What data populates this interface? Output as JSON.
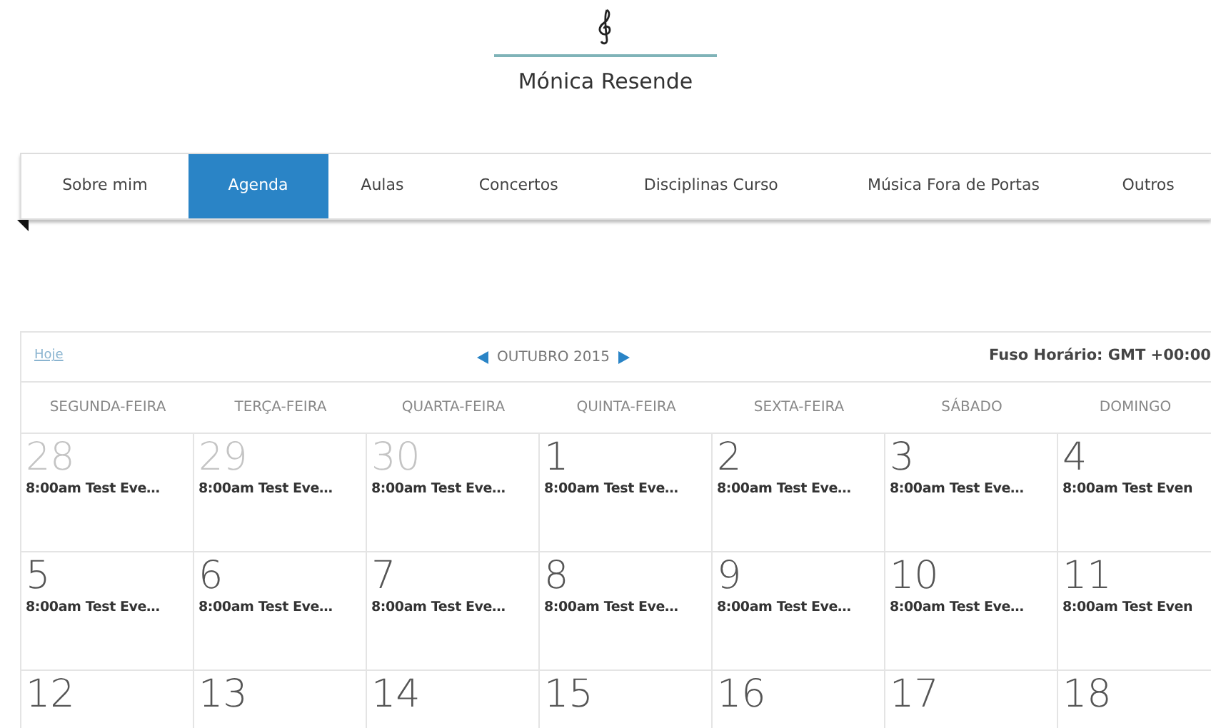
{
  "header": {
    "title": "Mónica Resende"
  },
  "nav": {
    "tabs": [
      {
        "label": "Sobre mim",
        "selected": false
      },
      {
        "label": "Agenda",
        "selected": true
      },
      {
        "label": "Aulas",
        "selected": false
      },
      {
        "label": "Concertos",
        "selected": false
      },
      {
        "label": "Disciplinas Curso",
        "selected": false
      },
      {
        "label": "Música Fora de Portas",
        "selected": false
      },
      {
        "label": "Outros",
        "selected": false
      }
    ]
  },
  "calendar": {
    "today_link": "Hoje",
    "month": "OUTUBRO 2015",
    "timezone": "Fuso Horário: GMT +00:00",
    "weekdays": [
      "SEGUNDA-FEIRA",
      "TERÇA-FEIRA",
      "QUARTA-FEIRA",
      "QUINTA-FEIRA",
      "SEXTA-FEIRA",
      "SÁBADO",
      "DOMINGO"
    ],
    "weeks": [
      [
        {
          "day": "28",
          "outside": true,
          "events": [
            "8:00am Test Eve…"
          ]
        },
        {
          "day": "29",
          "outside": true,
          "events": [
            "8:00am Test Eve…"
          ]
        },
        {
          "day": "30",
          "outside": true,
          "events": [
            "8:00am Test Eve…"
          ]
        },
        {
          "day": "1",
          "outside": false,
          "events": [
            "8:00am Test Eve…"
          ]
        },
        {
          "day": "2",
          "outside": false,
          "events": [
            "8:00am Test Eve…"
          ]
        },
        {
          "day": "3",
          "outside": false,
          "events": [
            "8:00am Test Eve…"
          ]
        },
        {
          "day": "4",
          "outside": false,
          "events": [
            "8:00am Test Even"
          ]
        }
      ],
      [
        {
          "day": "5",
          "outside": false,
          "events": [
            "8:00am Test Eve…"
          ]
        },
        {
          "day": "6",
          "outside": false,
          "events": [
            "8:00am Test Eve…"
          ]
        },
        {
          "day": "7",
          "outside": false,
          "events": [
            "8:00am Test Eve…"
          ]
        },
        {
          "day": "8",
          "outside": false,
          "events": [
            "8:00am Test Eve…"
          ]
        },
        {
          "day": "9",
          "outside": false,
          "events": [
            "8:00am Test Eve…"
          ]
        },
        {
          "day": "10",
          "outside": false,
          "events": [
            "8:00am Test Eve…"
          ]
        },
        {
          "day": "11",
          "outside": false,
          "events": [
            "8:00am Test Even"
          ]
        }
      ],
      [
        {
          "day": "12",
          "outside": false
        },
        {
          "day": "13",
          "outside": false
        },
        {
          "day": "14",
          "outside": false
        },
        {
          "day": "15",
          "outside": false
        },
        {
          "day": "16",
          "outside": false
        },
        {
          "day": "17",
          "outside": false
        },
        {
          "day": "18",
          "outside": false
        }
      ]
    ]
  }
}
